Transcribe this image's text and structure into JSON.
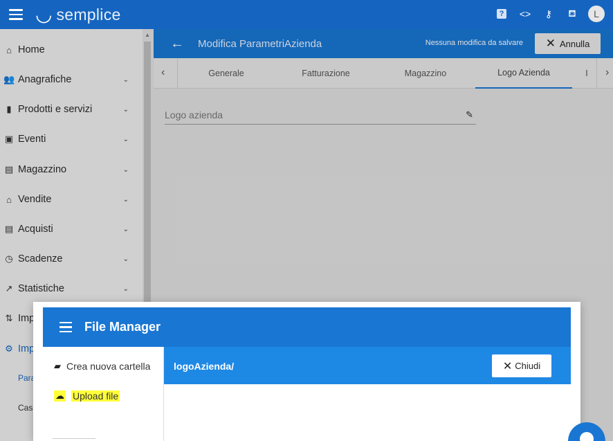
{
  "app": {
    "logo_glyph": "◡",
    "logo_text": "semplice"
  },
  "topbar": {
    "help_label": "?",
    "code_glyph": "<>",
    "key_glyph": "⚷",
    "paint_glyph": "⛾",
    "avatar_initial": "L"
  },
  "sidebar": {
    "items": [
      {
        "label": "Home",
        "icon": "home-icon",
        "glyph": "⌂"
      },
      {
        "label": "Anagrafiche",
        "icon": "people-icon",
        "glyph": "👥"
      },
      {
        "label": "Prodotti e servizi",
        "icon": "book-icon",
        "glyph": "▮"
      },
      {
        "label": "Eventi",
        "icon": "calendar-icon",
        "glyph": "▣"
      },
      {
        "label": "Magazzino",
        "icon": "store-icon",
        "glyph": "▤"
      },
      {
        "label": "Vendite",
        "icon": "basket-icon",
        "glyph": "⌂"
      },
      {
        "label": "Acquisti",
        "icon": "list-icon",
        "glyph": "▤"
      },
      {
        "label": "Scadenze",
        "icon": "clock-icon",
        "glyph": "◷"
      },
      {
        "label": "Statistiche",
        "icon": "trending-icon",
        "glyph": "↗"
      },
      {
        "label": "Imp",
        "icon": "import-export-icon",
        "glyph": "⇅"
      },
      {
        "label": "Imp",
        "icon": "settings-icon",
        "glyph": "⚙"
      }
    ],
    "subitems": [
      "Para",
      "Cas"
    ],
    "chevron": "⌄"
  },
  "form": {
    "back_glyph": "←",
    "title": "Modifica ParametriAzienda",
    "status": "Nessuna modifica da salvare",
    "cancel_label": "Annulla",
    "close_glyph": "✕",
    "tabs": [
      "Generale",
      "Fatturazione",
      "Magazzino",
      "Logo Azienda",
      "I"
    ],
    "active_tab": "Logo Azienda",
    "tab_prev": "‹",
    "tab_next": "›",
    "field_label": "Logo azienda",
    "edit_glyph": "✎"
  },
  "file_manager": {
    "title": "File Manager",
    "new_folder_label": "Crea nuova cartella",
    "new_folder_glyph": "▰",
    "upload_label": "Upload file",
    "upload_glyph": "☁",
    "path": "logoAzienda/",
    "close_label": "Chiudi",
    "close_glyph": "✕"
  },
  "colors": {
    "primary": "#1565c0",
    "header": "#1976d2",
    "path_bar": "#1e88e5",
    "highlight": "#ffff3a"
  }
}
